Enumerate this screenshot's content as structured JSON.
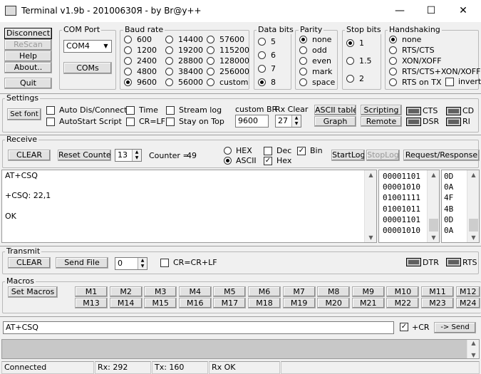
{
  "window": {
    "title": "Terminal v1.9b - 20100630Я - by Br@y++",
    "min_glyph": "—",
    "max_glyph": "☐",
    "close_glyph": "✕"
  },
  "conn_buttons": {
    "disconnect": "Disconnect",
    "rescan": "ReScan",
    "help": "Help",
    "about": "About..",
    "quit": "Quit"
  },
  "com_port": {
    "title": "COM Port",
    "value": "COM4",
    "coms_button": "COMs"
  },
  "baud_rate": {
    "title": "Baud rate",
    "options": [
      "600",
      "1200",
      "2400",
      "4800",
      "9600",
      "14400",
      "19200",
      "28800",
      "38400",
      "56000",
      "57600",
      "115200",
      "128000",
      "256000",
      "custom"
    ],
    "selected": "9600"
  },
  "data_bits": {
    "title": "Data bits",
    "options": [
      "5",
      "6",
      "7",
      "8"
    ],
    "selected": "8"
  },
  "parity": {
    "title": "Parity",
    "options": [
      "none",
      "odd",
      "even",
      "mark",
      "space"
    ],
    "selected": "none"
  },
  "stop_bits": {
    "title": "Stop bits",
    "options": [
      "1",
      "1.5",
      "2"
    ],
    "selected": "1"
  },
  "handshaking": {
    "title": "Handshaking",
    "options": [
      "none",
      "RTS/CTS",
      "XON/XOFF",
      "RTS/CTS+XON/XOFF",
      "RTS on TX"
    ],
    "selected": "none",
    "invert_label": "invert"
  },
  "settings": {
    "title": "Settings",
    "set_font": "Set font",
    "auto_dis_connect": "Auto Dis/Connect",
    "autostart_script": "AutoStart Script",
    "time": "Time",
    "cr_lf": "CR=LF",
    "stream_log": "Stream log",
    "stay_on_top": "Stay on Top",
    "custom_br_label": "custom BR",
    "custom_br_value": "9600",
    "rx_clear_label": "Rx Clear",
    "rx_clear_value": "27",
    "ascii_table": "ASCII table",
    "graph": "Graph",
    "scripting": "Scripting",
    "remote": "Remote",
    "leds": [
      "CTS",
      "DSR",
      "CD",
      "RI"
    ]
  },
  "receive": {
    "title": "Receive",
    "clear": "CLEAR",
    "reset_counter": "Reset Counter",
    "counter_spin": "13",
    "counter_label": "Counter =",
    "counter_value": "49",
    "hex": "HEX",
    "ascii": "ASCII",
    "dec": "Dec",
    "hex_chk": "Hex",
    "bin": "Bin",
    "mode_selected": "ASCII",
    "startlog": "StartLog",
    "stoplog": "StopLog",
    "req_resp": "Request/Response",
    "lines": [
      "AT+CSQ",
      "",
      "+CSQ: 22,1",
      "",
      "OK"
    ],
    "bin_lines": [
      "00001101",
      "00001010",
      "01001111",
      "01001011",
      "00001101",
      "00001010"
    ],
    "hex_lines": [
      "0D",
      "0A",
      "4F",
      "4B",
      "0D",
      "0A"
    ]
  },
  "transmit": {
    "title": "Transmit",
    "clear": "CLEAR",
    "send_file": "Send File",
    "spin_value": "0",
    "cr_crlf": "CR=CR+LF",
    "dtr": "DTR",
    "rts": "RTS"
  },
  "macros": {
    "title": "Macros",
    "set_macros": "Set Macros",
    "row1": [
      "M1",
      "M2",
      "M3",
      "M4",
      "M5",
      "M6",
      "M7",
      "M8",
      "M9",
      "M10",
      "M11",
      "M12"
    ],
    "row2": [
      "M13",
      "M14",
      "M15",
      "M16",
      "M17",
      "M18",
      "M19",
      "M20",
      "M21",
      "M22",
      "M23",
      "M24"
    ]
  },
  "send_bar": {
    "input_value": "AT+CSQ",
    "cr_label": "+CR",
    "send_button": "-> Send"
  },
  "status": {
    "connected": "Connected",
    "rx": "Rx: 292",
    "tx": "Tx: 160",
    "rx_ok": "Rx OK"
  }
}
